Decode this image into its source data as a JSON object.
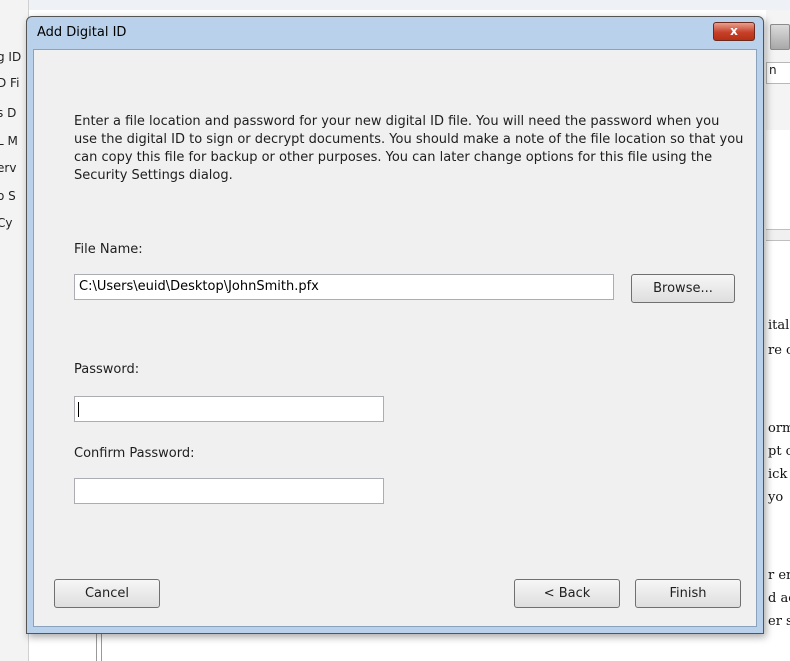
{
  "background": {
    "left_fragments": [
      "g ID",
      "D Fi",
      "s D",
      "L M",
      "erv",
      "o S",
      "Cy"
    ],
    "right_field_text": "n",
    "right_doc_lines": [
      "ital",
      "re c",
      "orm",
      "pt c",
      "ick",
      "yo",
      "r en",
      "d ac",
      "er s"
    ]
  },
  "dialog": {
    "title": "Add Digital ID",
    "close_label": "x",
    "intro": "Enter a file location and password for your new digital ID file. You will need the password when you use the digital ID to sign or decrypt documents. You should make a note of the file location so that you can copy this file for backup or other purposes. You can later change options for this file using the Security Settings dialog.",
    "file_name_label": "File Name:",
    "file_name_value": "C:\\Users\\euid\\Desktop\\JohnSmith.pfx",
    "browse_label": "Browse...",
    "password_label": "Password:",
    "password_value": "",
    "confirm_password_label": "Confirm Password:",
    "confirm_password_value": "",
    "cancel_label": "Cancel",
    "back_label": "< Back",
    "finish_label": "Finish"
  }
}
